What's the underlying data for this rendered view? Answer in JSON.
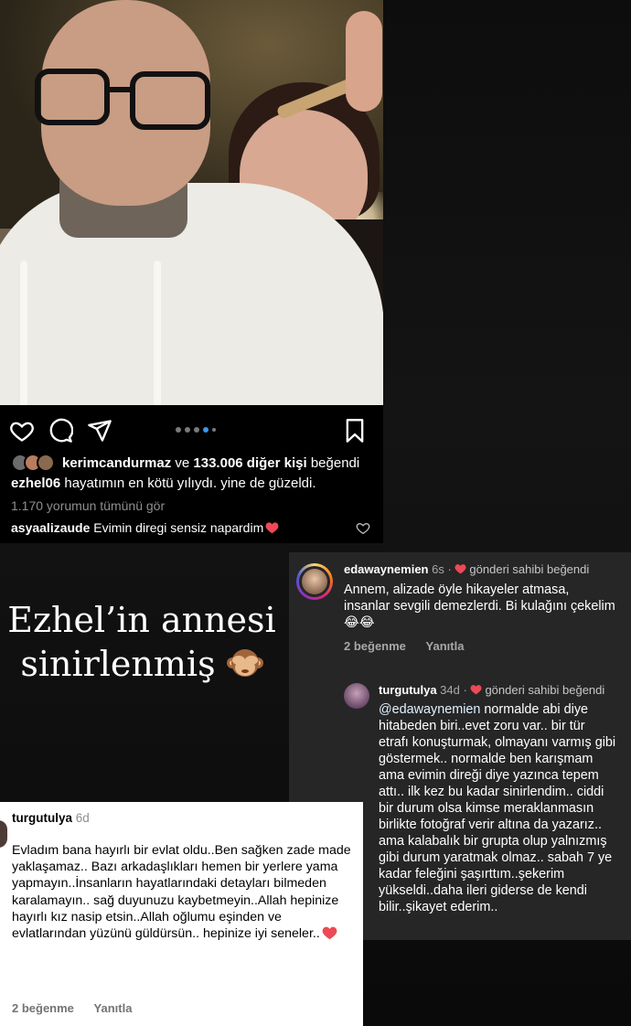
{
  "post": {
    "likes_users": "kerimcandurmaz",
    "likes_joiner": " ve ",
    "likes_others": "133.006 diğer kişi",
    "likes_suffix": " beğendi",
    "caption_user": "ezhel06",
    "caption_text": " hayatımın en kötü yılıydı. yine de güzeldi.",
    "view_all_comments": "1.170 yorumun tümünü gör",
    "top_comment_user": "asyaalizaude",
    "top_comment_text": " Evimin diregi sensiz napardim",
    "carousel_pages": 4,
    "carousel_active": 3
  },
  "story": {
    "headline_line1": "Ezhel’in annesi",
    "headline_line2": "sinirlenmiş"
  },
  "dark_comments": {
    "comment1": {
      "user": "edawaynemien",
      "time": " 6s",
      "liked_by_author": "gönderi sahibi beğendi",
      "text": "Annem, alizade öyle hikayeler atmasa, insanlar sevgili demezlerdi. Bi kulağını çekelim😂😂",
      "likes": "2 beğenme",
      "reply": "Yanıtla"
    },
    "comment2": {
      "user": "turgutulya",
      "time": " 34d",
      "liked_by_author": "gönderi sahibi beğendi",
      "mention": "@edawaynemien",
      "text": " normalde abi diye hitabeden biri..evet zoru var.. bir tür etrafı konuşturmak, olmayanı varmış gibi göstermek.. normalde ben karışmam ama evimin direği diye yazınca tepem attı.. ilk kez bu kadar sinirlendim.. ciddi bir durum olsa kimse meraklanmasın birlikte fotoğraf verir altına da yazarız.. ama kalabalık bir grupta olup yalnızmış gibi durum yaratmak olmaz.. sabah 7 ye kadar feleğini şaşırttım..şekerim yükseldi..daha ileri giderse de kendi bilir..şikayet ederim.."
    }
  },
  "white_comment": {
    "user": "turgutulya",
    "time": " 6d",
    "text": "Evladım bana hayırlı bir evlat oldu..Ben sağken zade made yaklaşamaz.. Bazı arkadaşlıkları hemen bir yerlere yama yapmayın..İnsanların hayatlarındaki detayları bilmeden karalamayın.. sağ duyunuzu kaybetmeyin..Allah hepinize hayırlı kız nasip etsin..Allah oğlumu eşinden ve evlatlarından yüzünü güldürsün.. hepinize iyi seneler..",
    "likes": "2 beğenme",
    "reply": "Yanıtla"
  },
  "icons": {
    "like": "heart-outline-icon",
    "comment": "comment-bubble-icon",
    "share": "paper-plane-icon",
    "save": "bookmark-icon",
    "liked_by_author": "red-heart-icon",
    "story_emoji": "see-no-evil-monkey-icon"
  },
  "colors": {
    "background": "#000000",
    "dark_panel": "#262626",
    "white_panel": "#ffffff",
    "heart_red": "#ed4956",
    "muted_text": "#a8a8a8"
  }
}
